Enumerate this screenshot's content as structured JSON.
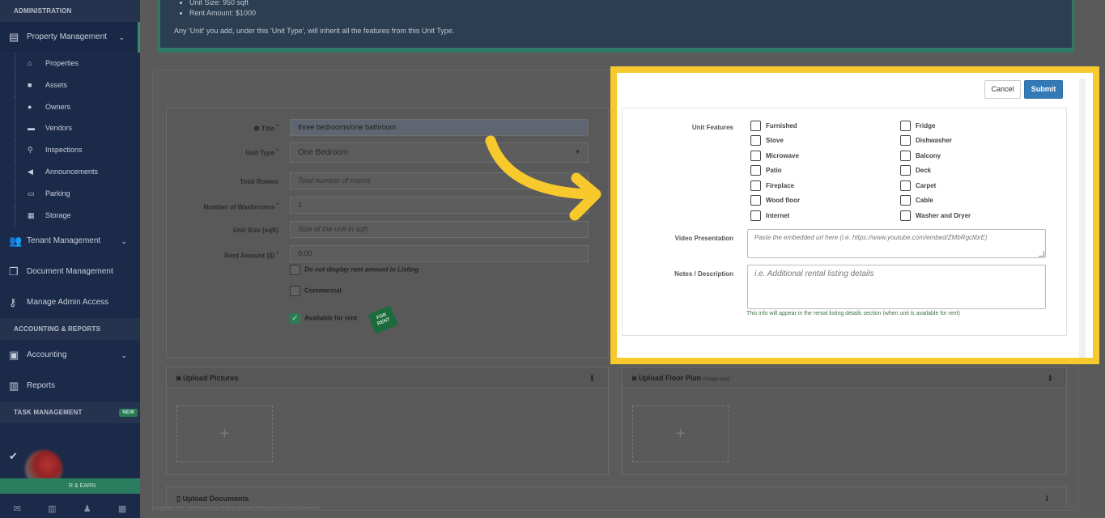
{
  "sidebar": {
    "administration_label": "ADMINISTRATION",
    "property_management": "Property Management",
    "sub_items": [
      "Properties",
      "Assets",
      "Owners",
      "Vendors",
      "Inspections",
      "Announcements",
      "Parking",
      "Storage"
    ],
    "tenant_management": "Tenant Management",
    "document_management": "Document Management",
    "manage_admin_access": "Manage Admin Access",
    "accounting_reports_label": "ACCOUNTING & REPORTS",
    "accounting": "Accounting",
    "reports": "Reports",
    "task_management_label": "TASK MANAGEMENT",
    "new_badge": "NEW",
    "refer_earn": "R & EARN"
  },
  "banner": {
    "items": [
      "Unit Size: 950 sqft",
      "Rent Amount: $1000"
    ],
    "note": "Any 'Unit' you add, under this 'Unit Type', will inherit all the features from this Unit Type."
  },
  "form": {
    "title_label": "Title",
    "title_value": "three bedrooms/one bathroom",
    "unit_type_label": "Unit Type",
    "unit_type_value": "One Bedroom",
    "total_rooms_label": "Total Rooms",
    "total_rooms_placeholder": "Total number of rooms",
    "washrooms_label": "Number of Washrooms",
    "washrooms_value": "1",
    "unit_size_label": "Unit Size (sqft)",
    "unit_size_placeholder": "Size of the unit in sqft",
    "rent_label": "Rent Amount ($)",
    "rent_value": "0.00",
    "hide_rent_label": "Do not display rent amount in Listing",
    "commercial_label": "Commercial",
    "available_label": "Available for rent",
    "for_rent_sign": "FOR RENT"
  },
  "uploads": {
    "pictures_title": "Upload Pictures",
    "floor_plan_title": "Upload Floor Plan",
    "floor_plan_note": "(image only)",
    "plus": "+",
    "documents_title": "Upload Documents"
  },
  "modal": {
    "cancel_label": "Cancel",
    "submit_label": "Submit",
    "unit_features_label": "Unit Features",
    "features_left": [
      "Furnished",
      "Stove",
      "Microwave",
      "Patio",
      "Fireplace",
      "Wood floor",
      "Internet"
    ],
    "features_right": [
      "Fridge",
      "Dishwasher",
      "Balcony",
      "Deck",
      "Carpet",
      "Cable",
      "Washer and Dryer"
    ],
    "video_label": "Video Presentation",
    "video_placeholder": "Paste the embedded url here (i.e. https://www.youtube.com/embed/ZMbRgclibrE)",
    "notes_label": "Notes / Description",
    "notes_placeholder": "i.e. Additional rental listing details",
    "notes_help": "This info will appear in the rental listing details section (when unit is available for rent)"
  },
  "footer": {
    "text": "© Copyright 2018 - 2024 Powered by MI Property Portal | Privacy Policy | Terms & Conditions"
  },
  "colors": {
    "highlight": "#f7c92d",
    "submit": "#337ab7",
    "sidebar": "#1c2a4a",
    "accent_green": "#2b7d60"
  }
}
